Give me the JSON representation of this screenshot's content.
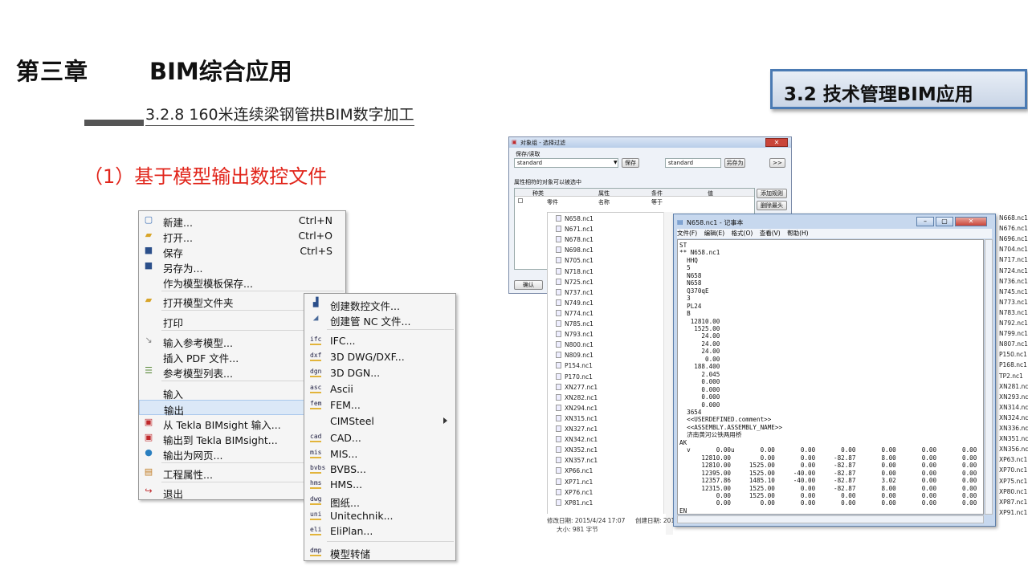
{
  "slide": {
    "chapter": "第三章",
    "chapter_title": "BIM综合应用",
    "section": "3.2.8 160米连续梁钢管拱BIM数字加工",
    "subtitle": "（1）基于模型输出数控文件",
    "badge": "3.2 技术管理BIM应用"
  },
  "file_menu": {
    "items": [
      {
        "label": "新建...",
        "shortcut": "Ctrl+N",
        "icon": "new-file-icon"
      },
      {
        "label": "打开...",
        "shortcut": "Ctrl+O",
        "icon": "open-folder-icon"
      },
      {
        "label": "保存",
        "shortcut": "Ctrl+S",
        "icon": "save-icon"
      },
      {
        "label": "另存为...",
        "shortcut": "",
        "icon": "save-as-icon"
      },
      {
        "label": "作为模型模板保存...",
        "shortcut": "",
        "icon": ""
      },
      {
        "label": "打开模型文件夹",
        "shortcut": "",
        "icon": "folder-icon"
      },
      {
        "label": "打印",
        "shortcut": "",
        "icon": ""
      },
      {
        "label": "输入参考模型...",
        "shortcut": "",
        "icon": "import-icon"
      },
      {
        "label": "插入 PDF 文件...",
        "shortcut": "",
        "icon": ""
      },
      {
        "label": "参考模型列表...",
        "shortcut": "",
        "icon": "list-icon"
      },
      {
        "label": "输入",
        "shortcut": "",
        "icon": ""
      },
      {
        "label": "输出",
        "shortcut": "",
        "icon": ""
      },
      {
        "label": "从 Tekla BIMsight 输入...",
        "shortcut": "",
        "icon": "bimsight-icon"
      },
      {
        "label": "输出到 Tekla BIMsight...",
        "shortcut": "",
        "icon": "bimsight-icon"
      },
      {
        "label": "输出为网页...",
        "shortcut": "",
        "icon": "globe-icon"
      },
      {
        "label": "工程属性...",
        "shortcut": "",
        "icon": "properties-icon"
      },
      {
        "label": "退出",
        "shortcut": "",
        "icon": "exit-icon"
      }
    ]
  },
  "export_menu": {
    "items": [
      {
        "label": "创建数控文件...",
        "icon": "nc-file-icon",
        "tag": ""
      },
      {
        "label": "创建管 NC 文件...",
        "icon": "tube-nc-icon",
        "tag": ""
      },
      {
        "label": "IFC...",
        "icon": "ifc-icon",
        "tag": "ifc"
      },
      {
        "label": "3D DWG/DXF...",
        "icon": "dxf-icon",
        "tag": "dxf"
      },
      {
        "label": "3D DGN...",
        "icon": "dgn-icon",
        "tag": "dgn"
      },
      {
        "label": "Ascii",
        "icon": "ascii-icon",
        "tag": "asc"
      },
      {
        "label": "FEM...",
        "icon": "fem-icon",
        "tag": "fem"
      },
      {
        "label": "CIMSteel",
        "icon": "",
        "tag": ""
      },
      {
        "label": "CAD...",
        "icon": "cad-icon",
        "tag": "cad"
      },
      {
        "label": "MIS...",
        "icon": "mis-icon",
        "tag": "mis"
      },
      {
        "label": "BVBS...",
        "icon": "bvbs-icon",
        "tag": "bvbs"
      },
      {
        "label": "HMS...",
        "icon": "hms-icon",
        "tag": "hms"
      },
      {
        "label": "图纸...",
        "icon": "dwg-icon",
        "tag": "dwg"
      },
      {
        "label": "Unitechnik...",
        "icon": "uni-icon",
        "tag": "uni"
      },
      {
        "label": "EliPlan...",
        "icon": "eli-icon",
        "tag": "eli"
      },
      {
        "label": "模型转储",
        "icon": "dmp-icon",
        "tag": "dmp"
      }
    ]
  },
  "object_dialog": {
    "title": "对象组 - 选择过滤",
    "group_label": "保存/读取",
    "preset_left": "standard",
    "save_btn": "保存",
    "preset_right": "standard",
    "saveas_btn": "另存为",
    "more_btn": ">>",
    "filter_label": "属性相符的对象可以被选中",
    "col_kind": "种类",
    "col_attr": "属性",
    "col_cond": "条件",
    "col_value": "值",
    "row1_kind": "零件",
    "row1_attr": "名称",
    "row1_cond": "等于",
    "add_rule_btn": "添加规则",
    "delete_btn": "删除最头",
    "ok_btn": "确认"
  },
  "file_list": {
    "files": [
      "N658.nc1",
      "N671.nc1",
      "N678.nc1",
      "N698.nc1",
      "N705.nc1",
      "N718.nc1",
      "N725.nc1",
      "N737.nc1",
      "N749.nc1",
      "N774.nc1",
      "N785.nc1",
      "N793.nc1",
      "N800.nc1",
      "N809.nc1",
      "P154.nc1",
      "P170.nc1",
      "XN277.nc1",
      "XN282.nc1",
      "XN294.nc1",
      "XN315.nc1",
      "XN327.nc1",
      "XN342.nc1",
      "XN352.nc1",
      "XN357.nc1",
      "XP66.nc1",
      "XP71.nc1",
      "XP76.nc1",
      "XP81.nc1"
    ],
    "modified": "修改日期: 2015/4/24 17:07",
    "created": "创建日期: 201",
    "size": "大小: 981 字节"
  },
  "right_list": {
    "files": [
      "N668.nc1",
      "N676.nc1",
      "N696.nc1",
      "N704.nc1",
      "N717.nc1",
      "N724.nc1",
      "N736.nc1",
      "N745.nc1",
      "N773.nc1",
      "N783.nc1",
      "N792.nc1",
      "N799.nc1",
      "N807.nc1",
      "P150.nc1",
      "P168.nc1",
      "TP2.nc1",
      "XN281.nc1",
      "XN293.nc1",
      "XN314.nc1",
      "XN324.nc1",
      "XN336.nc1",
      "XN351.nc1",
      "XN356.nc1",
      "XP63.nc1",
      "XP70.nc1",
      "XP75.nc1",
      "XP80.nc1",
      "XP87.nc1",
      "XP91.nc1"
    ]
  },
  "notepad": {
    "title": "N658.nc1 - 记事本",
    "menu": [
      "文件(F)",
      "编辑(E)",
      "格式(O)",
      "查看(V)",
      "帮助(H)"
    ],
    "content": "ST\n** N658.nc1\n  HHQ\n  5\n  N658\n  N658\n  Q370qE\n  3\n  PL24\n  B\n   12810.00\n    1525.00\n      24.00\n      24.00\n      24.00\n       0.00\n    188.400\n      2.045\n      0.000\n      0.000\n      0.000\n      0.000\n  3654\n  <<USERDEFINED.comment>>\n  <<ASSEMBLY.ASSEMBLY_NAME>>\n  济南黄河公铁两用桥\nAK\n  v       0.00u       0.00       0.00       0.00       0.00       0.00       0.00\n      12810.00        0.00       0.00     -82.87       8.00       0.00       0.00\n      12810.00     1525.00       0.00     -82.87       0.00       0.00       0.00\n      12395.00     1525.00     -40.00     -82.87       0.00       0.00       0.00\n      12357.86     1485.10     -40.00     -82.87       3.02       0.00       0.00\n      12315.00     1525.00       0.00     -82.87       8.00       0.00       0.00\n          0.00     1525.00       0.00       0.00       0.00       0.00       0.00\n          0.00        0.00       0.00       0.00       0.00       0.00       0.00\nEN"
  }
}
